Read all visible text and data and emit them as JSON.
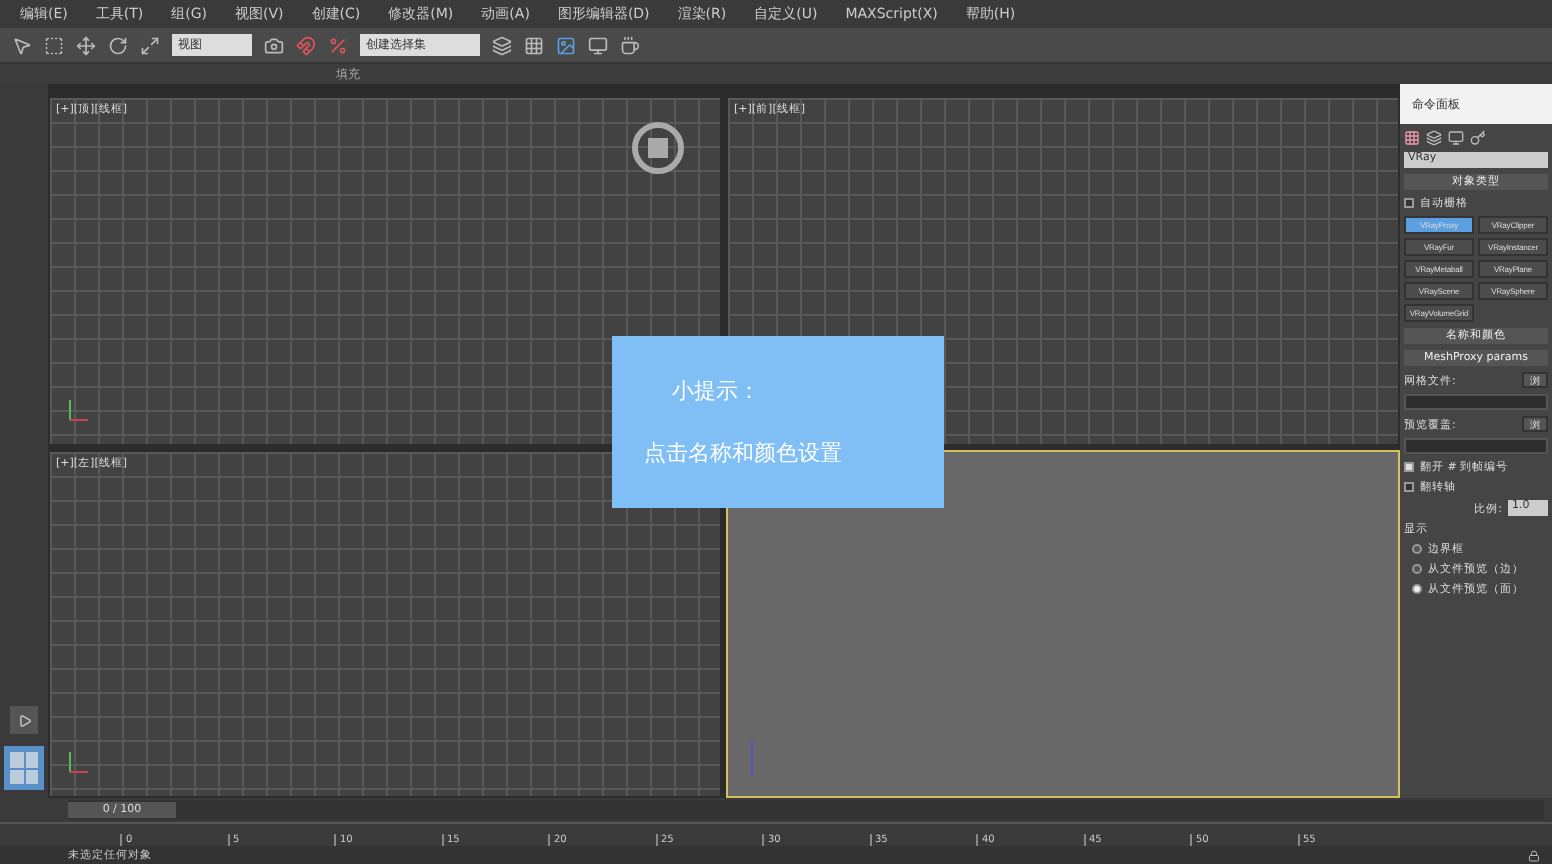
{
  "menu": [
    "编辑(E)",
    "工具(T)",
    "组(G)",
    "视图(V)",
    "创建(C)",
    "修改器(M)",
    "动画(A)",
    "图形编辑器(D)",
    "渲染(R)",
    "自定义(U)",
    "MAXScript(X)",
    "帮助(H)"
  ],
  "toolbar": {
    "view_dropdown": "视图",
    "selection_set": "创建选择集"
  },
  "ribbon_tabs": [
    {
      "label": "填充",
      "selected": false
    }
  ],
  "viewports": [
    {
      "label": "[+][顶][线框]",
      "kind": "ortho",
      "active": false
    },
    {
      "label": "[+][前][线框]",
      "kind": "ortho",
      "active": false
    },
    {
      "label": "[+][左][线框]",
      "kind": "ortho",
      "active": false
    },
    {
      "kind": "perspective",
      "active": true
    }
  ],
  "tip": {
    "title": "小提示：",
    "text": "点击名称和颜色设置"
  },
  "command_panel": {
    "title": "命令面板",
    "category": "VRay",
    "object_type": "对象类型",
    "autogrid": {
      "label": "自动栅格",
      "checked": false
    },
    "buttons": [
      {
        "label": "VRayProxy",
        "selected": true
      },
      {
        "label": "VRayClipper",
        "selected": false
      },
      {
        "label": "VRayFur",
        "selected": false
      },
      {
        "label": "VRayInstancer",
        "selected": false
      },
      {
        "label": "VRayMetaball",
        "selected": false
      },
      {
        "label": "VRayPlane",
        "selected": false
      },
      {
        "label": "VRayScene",
        "selected": false
      },
      {
        "label": "VRaySphere",
        "selected": false
      },
      {
        "label": "VRayVolumeGrid",
        "selected": false
      }
    ],
    "name_color": "名称和颜色",
    "rollout": "MeshProxy params",
    "mesh_file": "网格文件:",
    "browse_1": "浏",
    "preview_override": "预览覆盖:",
    "browse_2": "浏",
    "checks": [
      {
        "label": "翻开 # 到帧编号",
        "checked": true
      },
      {
        "label": "翻转轴",
        "checked": false
      }
    ],
    "scale_label": "比例:",
    "scale_value": "1.0",
    "display_title": "显示",
    "display_options": [
      {
        "label": "边界框",
        "selected": false
      },
      {
        "label": "从文件预览（边）",
        "selected": false
      },
      {
        "label": "从文件预览（面）",
        "selected": true
      }
    ]
  },
  "timeline": {
    "position": "0 / 100",
    "level": 0,
    "ticks": [
      "0",
      "5",
      "10",
      "15",
      "20",
      "25",
      "30",
      "35",
      "40",
      "45",
      "50",
      "55"
    ]
  },
  "status": "未选定任何对象"
}
